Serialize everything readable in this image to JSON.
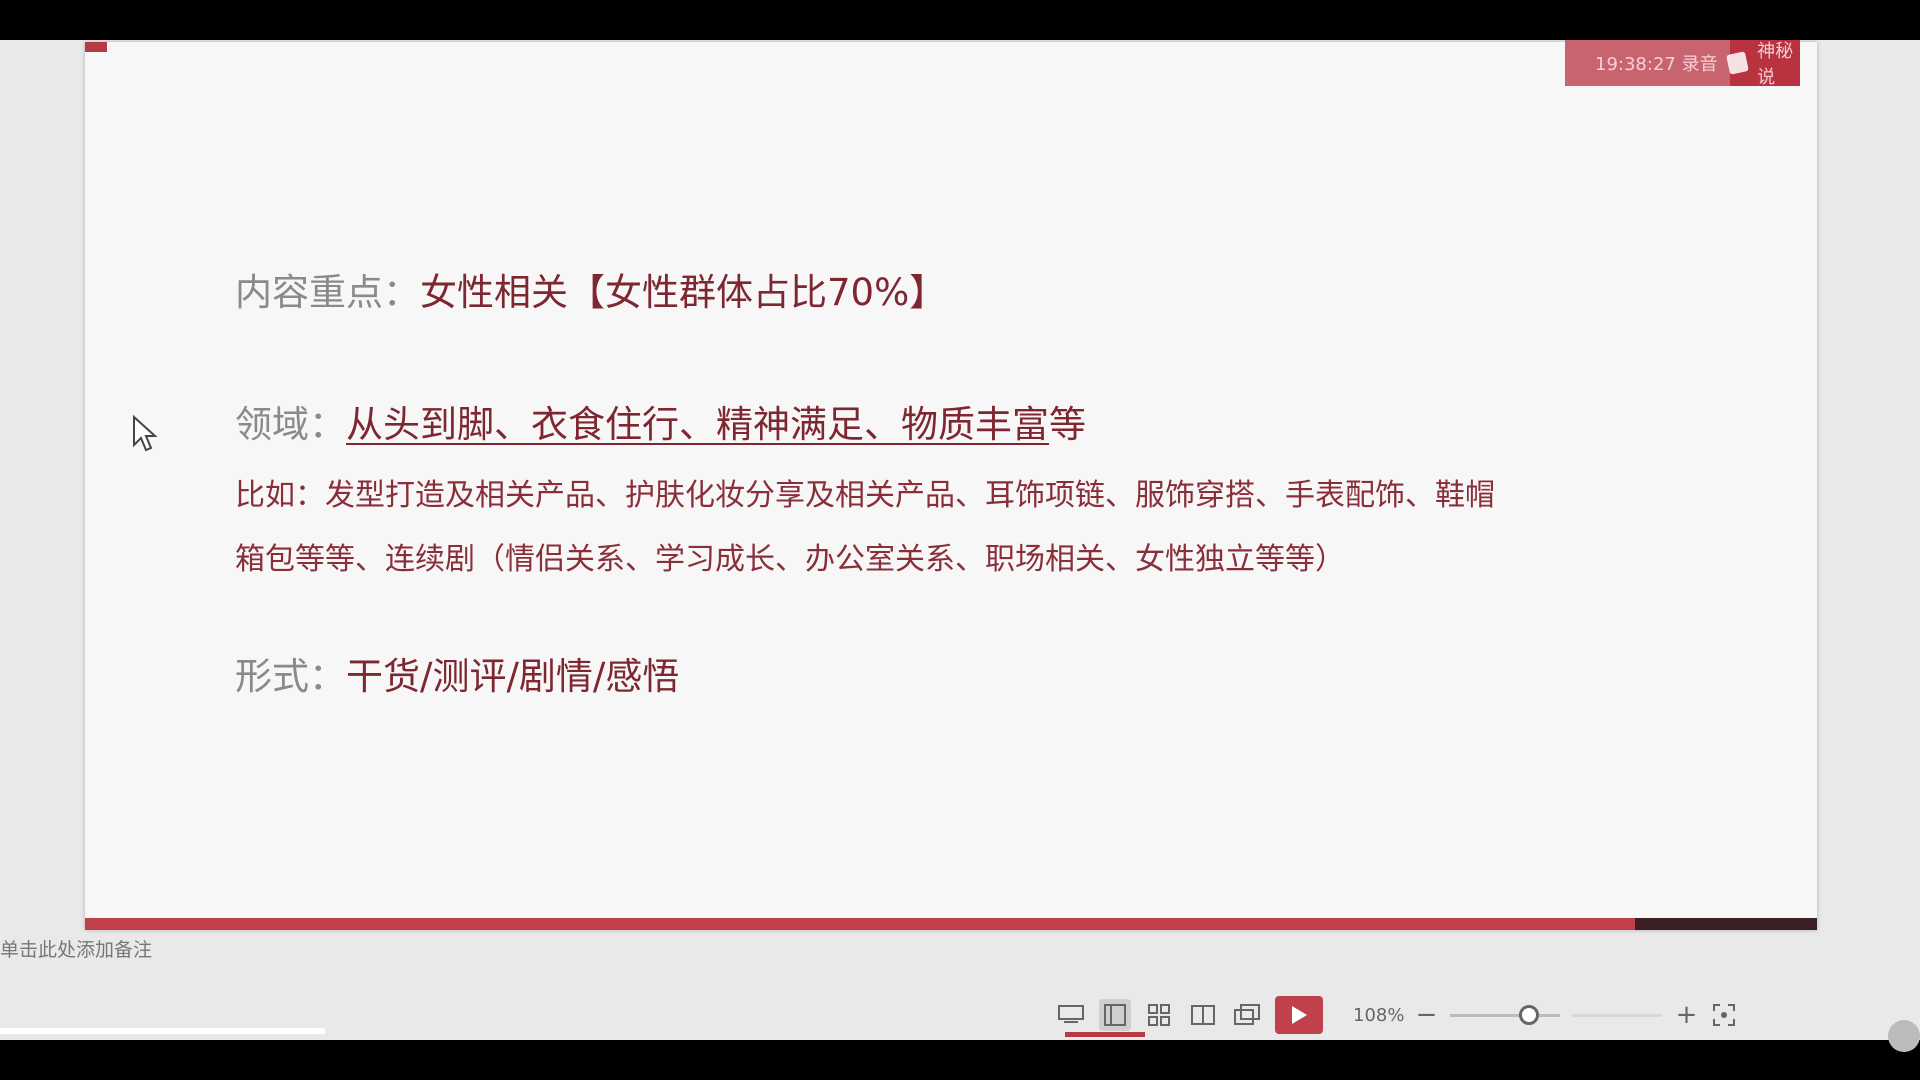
{
  "slide": {
    "line1_label": "内容重点：",
    "line1_value": "女性相关【女性群体占比70%】",
    "line2_label": "领域：",
    "line2_value": "从头到脚、衣食住行、精神满足、物质丰富",
    "line2_tail": "等",
    "line3": "比如：发型打造及相关产品、护肤化妆分享及相关产品、耳饰项链、服饰穿搭、手表配饰、鞋帽",
    "line4": "箱包等等、连续剧（情侣关系、学习成长、办公室关系、职场相关、女性独立等等）",
    "line5_label": "形式：",
    "line5_value": "干货/测评/剧情/感悟"
  },
  "recording_badge": {
    "time": "19:38:27 录音",
    "name": "神秘说"
  },
  "notes": {
    "placeholder": "单击此处添加备注"
  },
  "statusbar": {
    "zoom": "108%",
    "zoom_level": 0.62,
    "progress": 0.895
  },
  "colors": {
    "accent": "#c0404c",
    "text_red": "#7e2730"
  }
}
